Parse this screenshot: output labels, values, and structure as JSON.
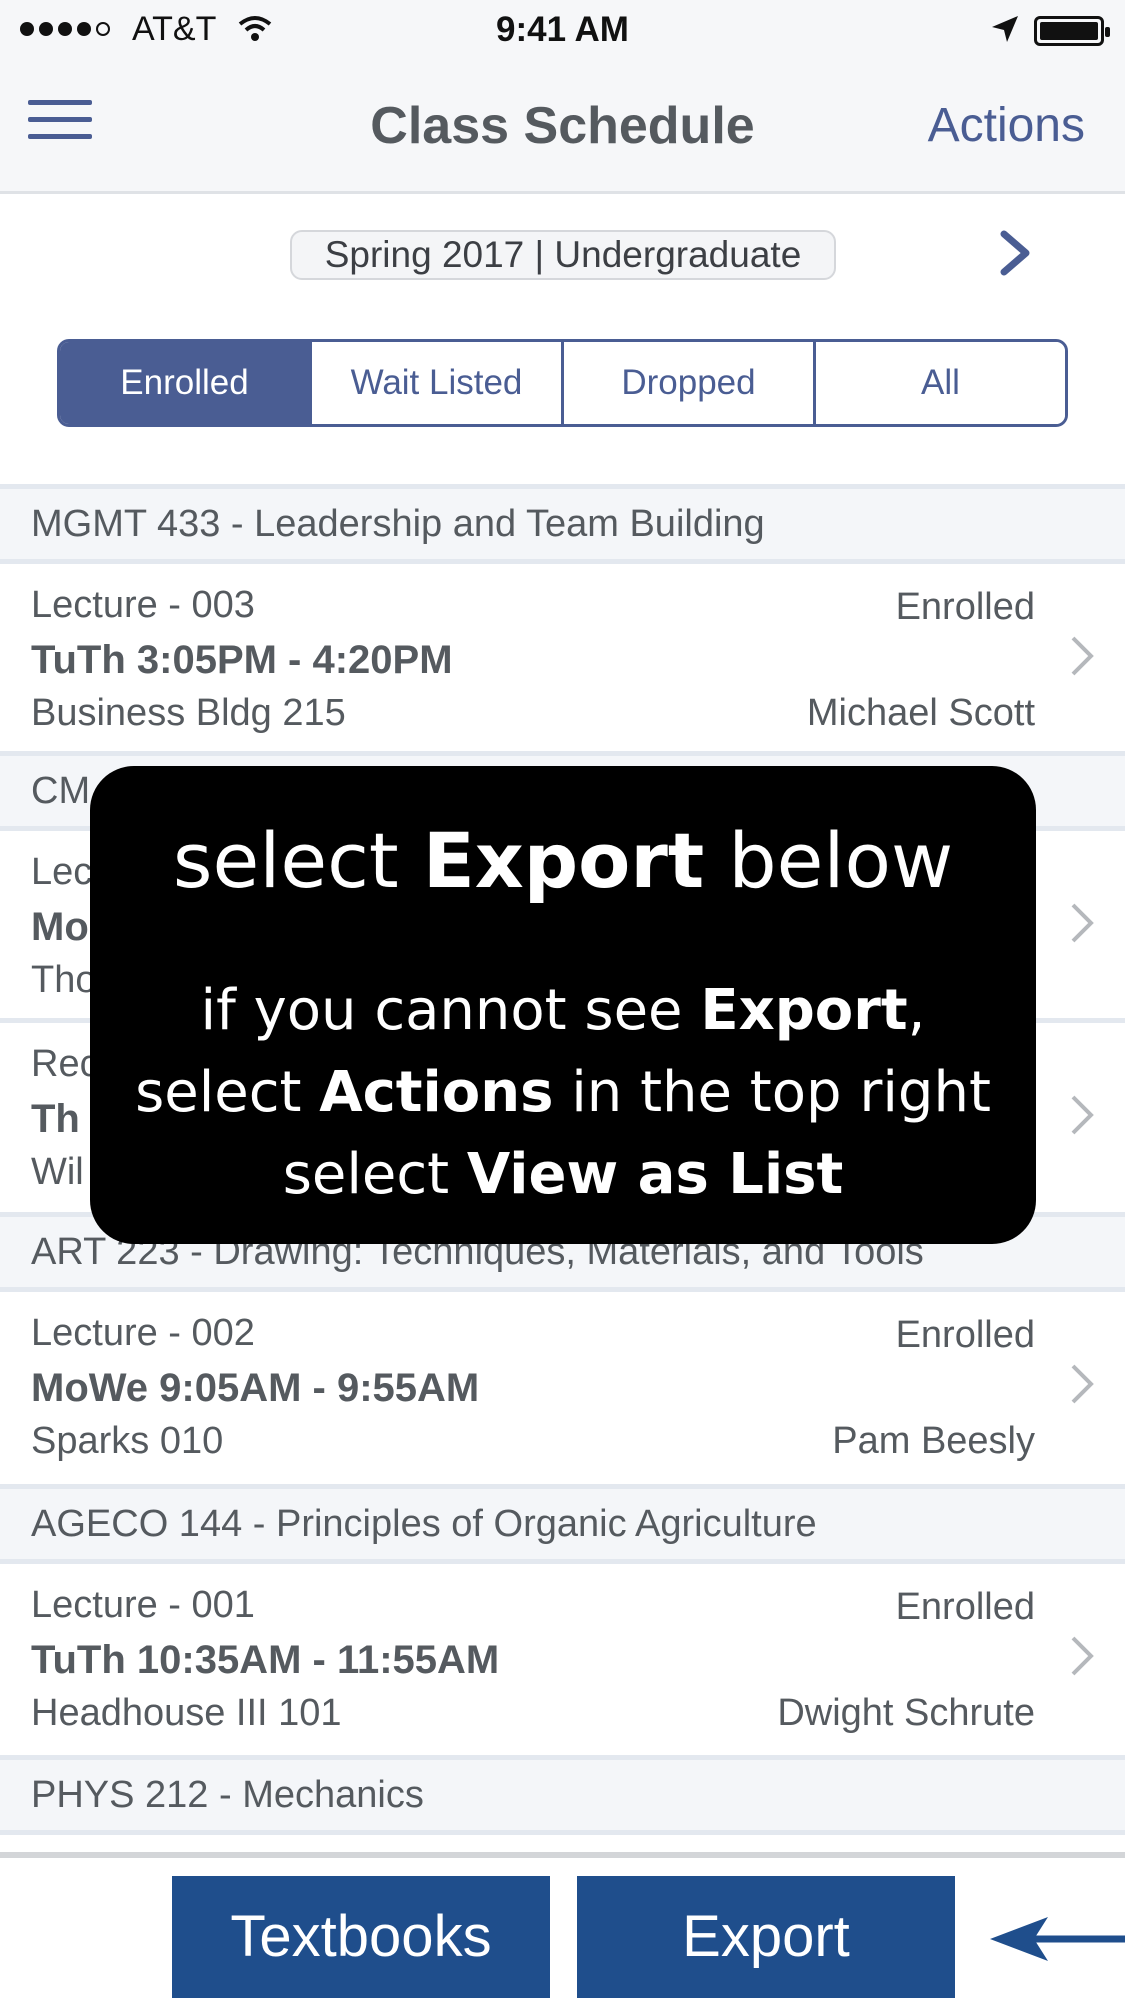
{
  "status_bar": {
    "carrier": "AT&T",
    "time": "9:41 AM"
  },
  "nav": {
    "title": "Class Schedule",
    "actions_label": "Actions"
  },
  "term": {
    "label": "Spring 2017 | Undergraduate"
  },
  "tabs": [
    {
      "label": "Enrolled",
      "active": true
    },
    {
      "label": "Wait Listed",
      "active": false
    },
    {
      "label": "Dropped",
      "active": false
    },
    {
      "label": "All",
      "active": false
    }
  ],
  "courses": [
    {
      "title": "MGMT 433 - Leadership and Team Building",
      "section": {
        "component": "Lecture - 003",
        "meeting": "TuTh 3:05PM - 4:20PM",
        "room": "Business Bldg 215",
        "status": "Enrolled",
        "instructor": "Michael Scott"
      }
    },
    {
      "title": "CM",
      "sections": [
        {
          "component": "Lec",
          "meeting": "Mo",
          "room": "Tho"
        },
        {
          "component": "Rec",
          "meeting": "Th",
          "room": "Wil"
        }
      ]
    },
    {
      "title": "ART 223 - Drawing: Techniques, Materials, and Tools",
      "section": {
        "component": "Lecture - 002",
        "meeting": "MoWe 9:05AM - 9:55AM",
        "room": "Sparks 010",
        "status": "Enrolled",
        "instructor": "Pam Beesly"
      }
    },
    {
      "title": "AGECO 144 - Principles of Organic Agriculture",
      "section": {
        "component": "Lecture - 001",
        "meeting": "TuTh 10:35AM - 11:55AM",
        "room": "Headhouse III 101",
        "status": "Enrolled",
        "instructor": "Dwight Schrute"
      }
    },
    {
      "title": "PHYS 212 - Mechanics"
    }
  ],
  "overlay": {
    "line1_a": "select ",
    "line1_b": "Export",
    "line1_c": " below",
    "line2_a": "if you cannot see ",
    "line2_b": "Export",
    "line2_c": ",",
    "line3_a": "select ",
    "line3_b": "Actions",
    "line3_c": " in the top right",
    "line4_a": "select ",
    "line4_b": "View as List"
  },
  "toolbar": {
    "textbooks_label": "Textbooks",
    "export_label": "Export"
  },
  "colors": {
    "accent": "#4a5d93",
    "toolbar_button": "#1f4e8c",
    "header_bg": "#f4f6f9"
  }
}
